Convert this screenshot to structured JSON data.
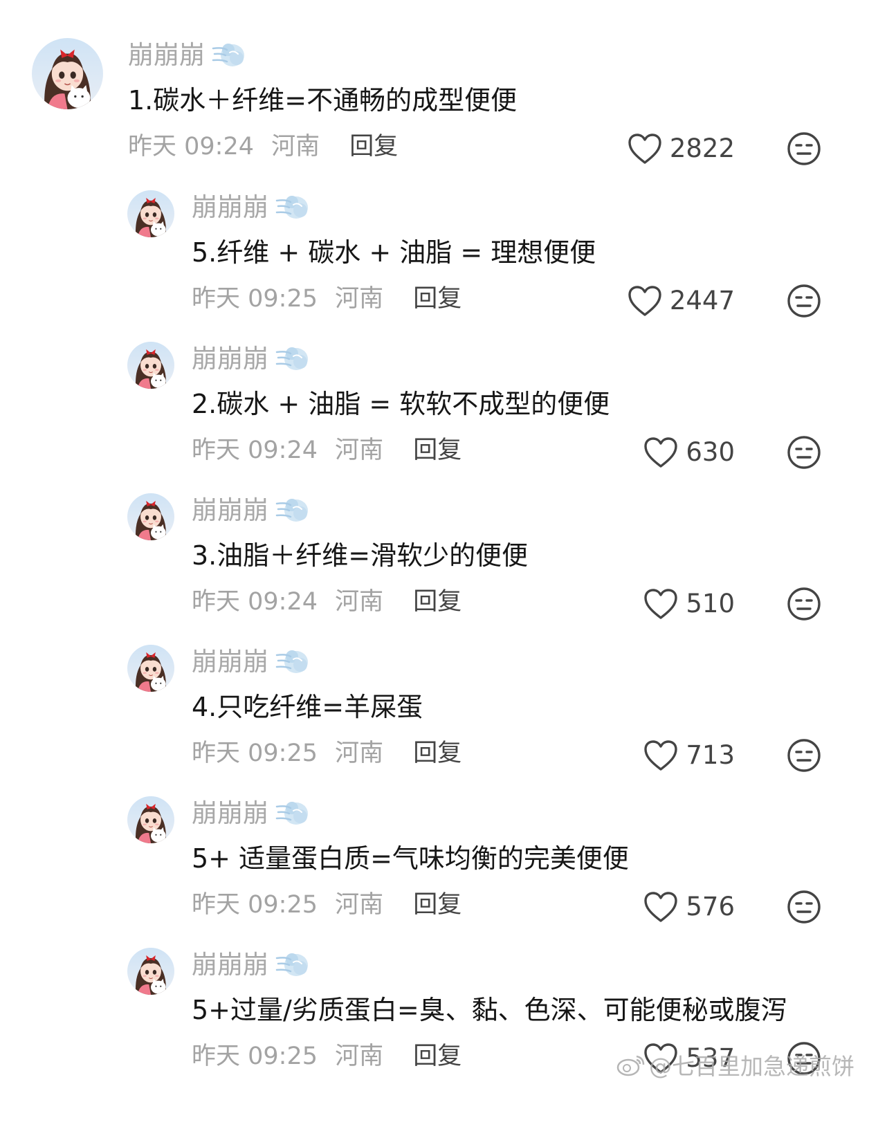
{
  "comments": [
    {
      "username": "崩崩崩",
      "text": "1.碳水＋纤维=不通畅的成型便便",
      "time": "昨天 09:24",
      "location": "河南",
      "reply_label": "回复",
      "likes": "2822"
    },
    {
      "username": "崩崩崩",
      "text": "5.纤维 + 碳水 + 油脂 = 理想便便",
      "time": "昨天 09:25",
      "location": "河南",
      "reply_label": "回复",
      "likes": "2447"
    },
    {
      "username": "崩崩崩",
      "text": "2.碳水 + 油脂 = 软软不成型的便便",
      "time": "昨天 09:24",
      "location": "河南",
      "reply_label": "回复",
      "likes": "630"
    },
    {
      "username": "崩崩崩",
      "text": "3.油脂＋纤维=滑软少的便便",
      "time": "昨天 09:24",
      "location": "河南",
      "reply_label": "回复",
      "likes": "510"
    },
    {
      "username": "崩崩崩",
      "text": "4.只吃纤维=羊屎蛋",
      "time": "昨天 09:25",
      "location": "河南",
      "reply_label": "回复",
      "likes": "713"
    },
    {
      "username": "崩崩崩",
      "text": "5+ 适量蛋白质=气味均衡的完美便便",
      "time": "昨天 09:25",
      "location": "河南",
      "reply_label": "回复",
      "likes": "576"
    },
    {
      "username": "崩崩崩",
      "text": "5+过量/劣质蛋白=臭、黏、色深、可能便秘或腹泻",
      "time": "昨天 09:25",
      "location": "河南",
      "reply_label": "回复",
      "likes": "537"
    }
  ],
  "watermark": "@七百里加急递煎饼",
  "colors": {
    "username": "#a8a8a8",
    "text": "#161616",
    "meta": "#a3a3a3",
    "icon": "#444444"
  }
}
